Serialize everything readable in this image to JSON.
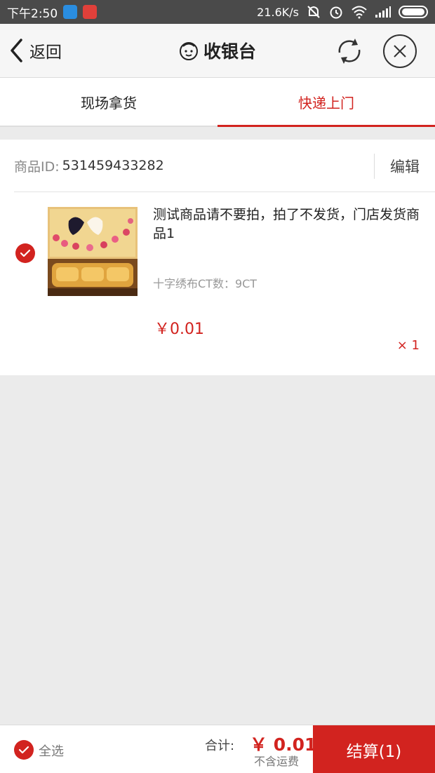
{
  "status_bar": {
    "time": "下午2:50",
    "net_speed": "21.6K/s"
  },
  "header": {
    "back_label": "返回",
    "title": "收银台",
    "icons": [
      "chevron-left-icon",
      "service-face-icon",
      "refresh-icon",
      "close-icon"
    ]
  },
  "tabs": [
    {
      "label": "现场拿货",
      "active": false
    },
    {
      "label": "快递上门",
      "active": true
    }
  ],
  "product": {
    "id_label": "商品ID:",
    "id_value": "531459433282",
    "edit_label": "编辑",
    "title": "测试商品请不要拍，拍了不发货，门店发货商品1",
    "spec": "十字绣布CT数：9CT",
    "price": "￥0.01",
    "quantity": "× 1",
    "checked": true
  },
  "bottom_bar": {
    "select_all_label": "全选",
    "total_label": "合计:",
    "total_value": "￥ 0.01",
    "shipping_note": "不含运费",
    "checkout_label": "结算(1)"
  },
  "colors": {
    "accent": "#d2231f",
    "header_bg": "#f6f6f6",
    "page_bg": "#ebebeb",
    "status_bar_bg": "#4a4a4a"
  }
}
